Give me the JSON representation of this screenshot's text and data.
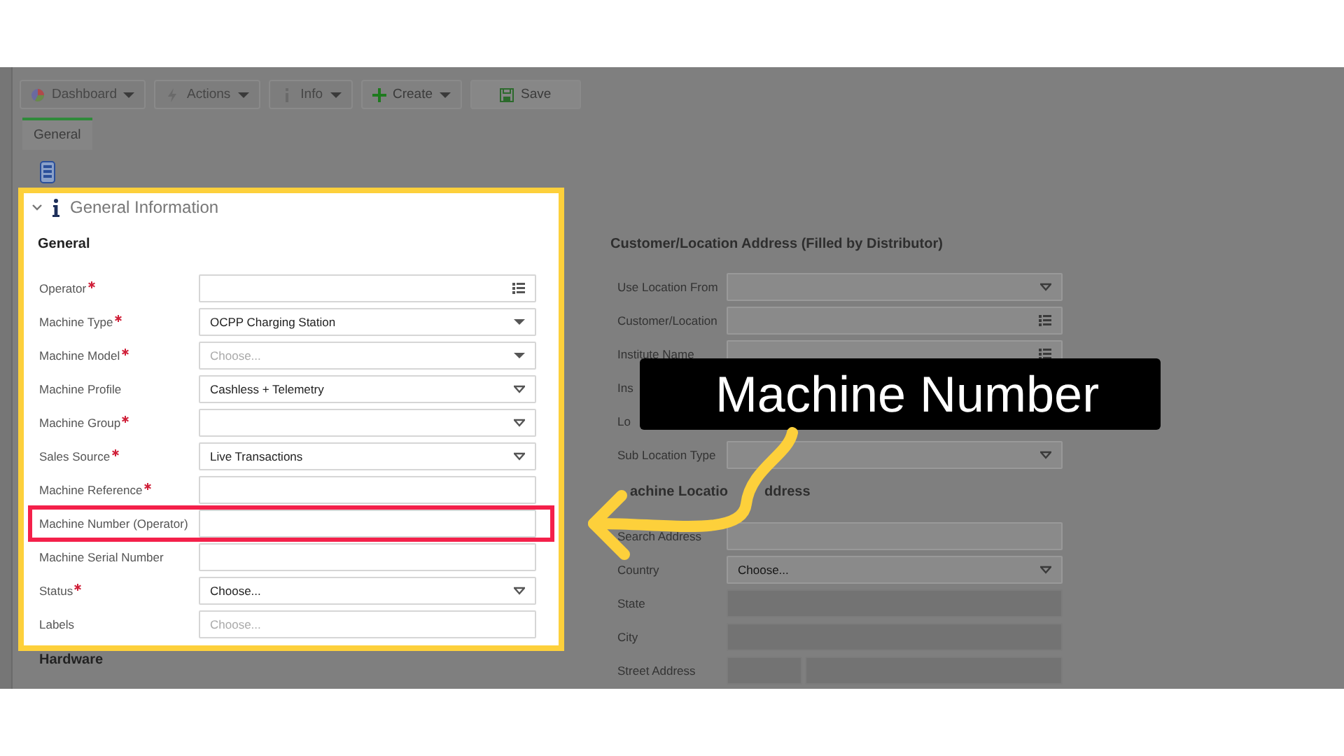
{
  "toolbar": [
    {
      "kind": "dashboard",
      "label": "Dashboard",
      "menu": true,
      "disabled": true
    },
    {
      "kind": "actions",
      "label": "Actions",
      "menu": true,
      "disabled": true
    },
    {
      "kind": "info",
      "label": "Info",
      "menu": true,
      "disabled": true
    },
    {
      "kind": "create",
      "label": "Create",
      "menu": true,
      "disabled": false
    },
    {
      "kind": "save",
      "label": "Save",
      "menu": false,
      "disabled": false
    }
  ],
  "tabs": [
    {
      "label": "General",
      "selected": true
    }
  ],
  "section": {
    "title": "General Information",
    "expanded": true,
    "heading": "General",
    "fields": [
      {
        "label": "Operator",
        "required": true,
        "kind": "list",
        "highlighted": false
      },
      {
        "label": "Machine Type",
        "required": true,
        "kind": "select",
        "value": "OCPP Charging Station",
        "highlighted": false
      },
      {
        "label": "Machine Model",
        "required": true,
        "kind": "select",
        "placeholder": "Choose...",
        "highlighted": false
      },
      {
        "label": "Machine Profile",
        "required": false,
        "kind": "combo",
        "value": "Cashless + Telemetry",
        "highlighted": false
      },
      {
        "label": "Machine Group",
        "required": true,
        "kind": "combo",
        "highlighted": false
      },
      {
        "label": "Sales Source",
        "required": true,
        "kind": "combo",
        "value": "Live Transactions",
        "highlighted": false
      },
      {
        "label": "Machine Reference",
        "required": true,
        "kind": "text",
        "highlighted": false
      },
      {
        "label": "Machine Number (Operator)",
        "required": false,
        "kind": "text",
        "highlighted": true
      },
      {
        "label": "Machine Serial Number",
        "required": false,
        "kind": "text",
        "highlighted": false
      },
      {
        "label": "Status",
        "required": true,
        "kind": "combo",
        "value": "Choose...",
        "highlighted": false
      },
      {
        "label": "Labels",
        "required": false,
        "kind": "text",
        "placeholder": "Choose...",
        "highlighted": false
      }
    ],
    "next_heading": "Hardware"
  },
  "customer_address": {
    "heading": "Customer/Location Address (Filled by Distributor)",
    "fields": [
      {
        "label": "Use Location From",
        "kind": "combo"
      },
      {
        "label": "Customer/Location",
        "kind": "list"
      },
      {
        "label": "Institute Name",
        "kind": "list"
      },
      {
        "label": "Ins"
      },
      {
        "label": "Lo"
      },
      {
        "label": "Sub Location Type",
        "kind": "combo"
      }
    ]
  },
  "machine_location_address": {
    "heading": [
      "achine Locatio",
      "ddress"
    ],
    "fields": [
      {
        "label": "Search Address",
        "kind": "text",
        "disabled": false
      },
      {
        "label": "Country",
        "kind": "combo",
        "value": "Choose...",
        "disabled": false
      },
      {
        "label": "State",
        "kind": "text",
        "disabled": true
      },
      {
        "label": "City",
        "kind": "text",
        "disabled": true
      },
      {
        "label": "Street Address",
        "kind": "split",
        "disabled": true
      }
    ]
  },
  "callout": {
    "text": "Machine Number"
  }
}
